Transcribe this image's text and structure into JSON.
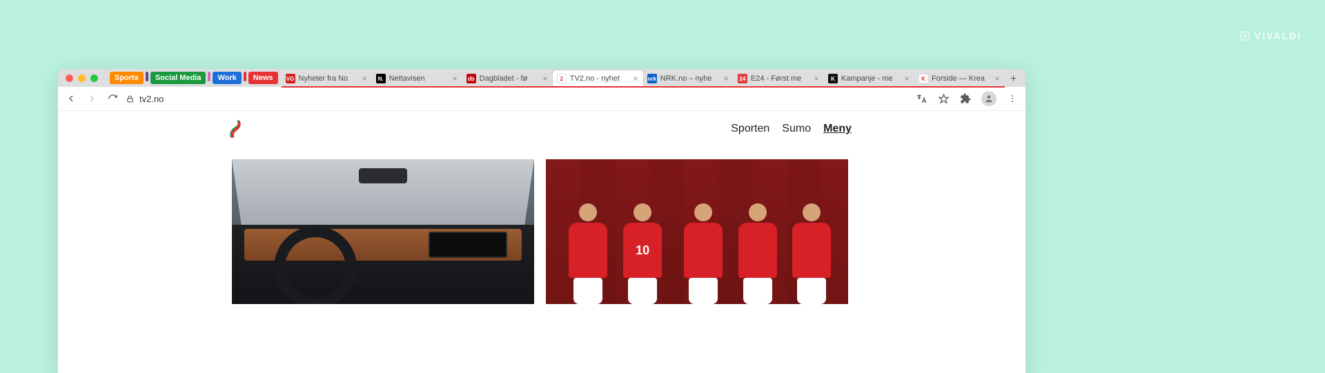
{
  "watermark": {
    "text": "VIVALDI"
  },
  "stacks": [
    {
      "name": "sports",
      "label": "Sports",
      "bg": "#ff8a00",
      "after": "#6b3d8f"
    },
    {
      "name": "social",
      "label": "Social Media",
      "bg": "#1a9a3f",
      "after": "#d26bb0"
    },
    {
      "name": "work",
      "label": "Work",
      "bg": "#1d6fd8",
      "after": "#e53333"
    },
    {
      "name": "news",
      "label": "News",
      "bg": "#e53333",
      "after": null
    }
  ],
  "tabs": [
    {
      "id": "nyheter",
      "title": "Nyheter fra No",
      "favicon_bg": "#d32222",
      "favicon_txt": "VG",
      "news_group": true
    },
    {
      "id": "nettavisen",
      "title": "Nettavisen",
      "favicon_bg": "#000000",
      "favicon_txt": "N.",
      "news_group": true
    },
    {
      "id": "dagbladet",
      "title": "Dagbladet - fø",
      "favicon_bg": "#c40808",
      "favicon_txt": "db",
      "news_group": true
    },
    {
      "id": "tv2",
      "title": "TV2.no - nyhet",
      "favicon_bg": "#ffffff",
      "favicon_txt": "2",
      "news_group": true,
      "active": true
    },
    {
      "id": "nrk",
      "title": "NRK.no – nyhe",
      "favicon_bg": "#0a62c7",
      "favicon_txt": "nrk",
      "news_group": true
    },
    {
      "id": "e24",
      "title": "E24 - Først me",
      "favicon_bg": "#e23d3d",
      "favicon_txt": "24",
      "news_group": true
    },
    {
      "id": "kampanje",
      "title": "Kampanje - me",
      "favicon_bg": "#111111",
      "favicon_txt": "K",
      "news_group": true
    },
    {
      "id": "kreativt",
      "title": "Forside — Krea",
      "favicon_bg": "#ffffff",
      "favicon_txt": "K",
      "favicon_fg": "#e03030",
      "news_group": true
    }
  ],
  "address": {
    "url": "tv2.no",
    "secure": true
  },
  "site": {
    "nav": {
      "sporten": "Sporten",
      "sumo": "Sumo",
      "meny": "Meny"
    },
    "card_b_number": "10"
  }
}
